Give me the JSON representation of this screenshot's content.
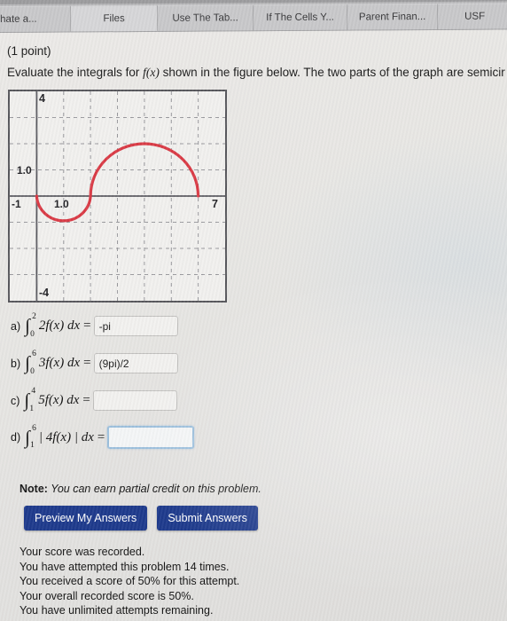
{
  "browser": {
    "tabs": [
      {
        "label": "hate a...",
        "active": false
      },
      {
        "label": "Files",
        "active": true
      },
      {
        "label": "Use The Tab...",
        "active": false
      },
      {
        "label": "If The Cells Y...",
        "active": false
      },
      {
        "label": "Parent Finan...",
        "active": false
      },
      {
        "label": "USF",
        "active": false
      }
    ]
  },
  "problem": {
    "points": "(1 point)",
    "prompt_before": "Evaluate the integrals for ",
    "prompt_fx": "f(x)",
    "prompt_after": " shown in the figure below. The two parts of the graph are semicir"
  },
  "chart_data": {
    "type": "line",
    "title": "",
    "xlabel": "",
    "ylabel": "",
    "xlim": [
      -1,
      7
    ],
    "ylim": [
      -4,
      4
    ],
    "grid": true,
    "grid_step": 1,
    "axis_tick_labels": {
      "y_top": "4",
      "y_one": "1.0",
      "y_bottom": "-4",
      "x_left": "-1",
      "x_one": "1.0",
      "x_right": "7"
    },
    "curve_color": "#d93a45",
    "series": [
      {
        "name": "f(x) lower semicircle",
        "shape": "semicircle",
        "center": [
          1,
          0
        ],
        "radius": 1,
        "orientation": "below-axis",
        "x_range": [
          0,
          2
        ],
        "y_extreme": -1
      },
      {
        "name": "f(x) upper semicircle",
        "shape": "semicircle",
        "center": [
          4,
          0
        ],
        "radius": 2,
        "orientation": "above-axis",
        "x_range": [
          2,
          6
        ],
        "y_extreme": 2
      }
    ]
  },
  "answers": [
    {
      "letter": "a)",
      "lower": "0",
      "upper": "2",
      "integrand": "2f(x) dx",
      "coef": "2",
      "value": "-pi",
      "placeholder": "",
      "focused": false
    },
    {
      "letter": "b)",
      "lower": "0",
      "upper": "6",
      "integrand": "3f(x) dx",
      "coef": "3",
      "value": "(9pi)/2",
      "placeholder": "",
      "focused": false
    },
    {
      "letter": "c)",
      "lower": "1",
      "upper": "4",
      "integrand": "5f(x) dx",
      "coef": "5",
      "value": "",
      "placeholder": "",
      "focused": false
    },
    {
      "letter": "d)",
      "lower": "1",
      "upper": "6",
      "integrand": "| 4f(x) |  dx",
      "coef": "4",
      "value": "",
      "placeholder": "",
      "focused": true
    }
  ],
  "note": {
    "label": "Note:",
    "text": " You can earn partial credit on this problem."
  },
  "buttons": {
    "preview": "Preview My Answers",
    "submit": "Submit Answers",
    "color": "#1e3a8c"
  },
  "score": {
    "lines": [
      "Your score was recorded.",
      "You have attempted this problem 14 times.",
      "You received a score of 50% for this attempt.",
      "Your overall recorded score is 50%.",
      "You have unlimited attempts remaining."
    ]
  }
}
